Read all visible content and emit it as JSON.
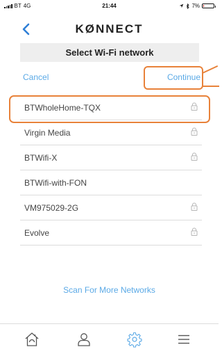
{
  "status_bar": {
    "carrier": "BT",
    "network": "4G",
    "time": "21:44",
    "battery": "7%",
    "battery_level": 0.07
  },
  "header": {
    "brand": "KØNNECT",
    "back_icon": "chevron-left-icon"
  },
  "page": {
    "title": "Select Wi-Fi network"
  },
  "actions": {
    "cancel_label": "Cancel",
    "continue_label": "Continue"
  },
  "networks": [
    {
      "name": "BTWholeHome-TQX",
      "secured": true
    },
    {
      "name": "Virgin Media",
      "secured": true
    },
    {
      "name": "BTWifi-X",
      "secured": true
    },
    {
      "name": "BTWifi-with-FON",
      "secured": false
    },
    {
      "name": "VM975029-2G",
      "secured": true
    },
    {
      "name": "Evolve",
      "secured": true
    }
  ],
  "scan": {
    "label": "Scan For More Networks"
  },
  "tab_bar": {
    "items": [
      {
        "icon": "home-icon",
        "active": false
      },
      {
        "icon": "user-icon",
        "active": false
      },
      {
        "icon": "gear-icon",
        "active": true
      },
      {
        "icon": "menu-icon",
        "active": false
      }
    ]
  },
  "colors": {
    "accent": "#5aa9e6",
    "highlight": "#e8823a",
    "title_bar": "#eeeeee"
  }
}
